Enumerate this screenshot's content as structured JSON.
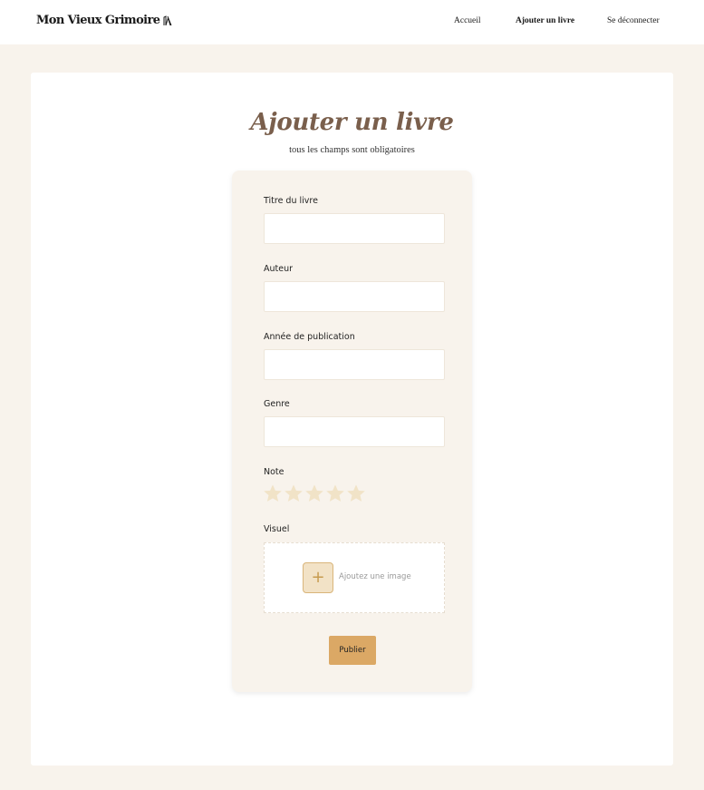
{
  "header": {
    "logo_text": "Mon Vieux Grimoire",
    "nav": {
      "home": "Accueil",
      "add_book": "Ajouter un livre",
      "logout": "Se déconnecter"
    }
  },
  "page": {
    "title": "Ajouter un livre",
    "subtitle": "tous les champs sont obligatoires"
  },
  "form": {
    "fields": {
      "title_label": "Titre du livre",
      "title_value": "",
      "author_label": "Auteur",
      "author_value": "",
      "year_label": "Année de publication",
      "year_value": "",
      "genre_label": "Genre",
      "genre_value": ""
    },
    "rating": {
      "label": "Note",
      "value": 0,
      "max": 5
    },
    "visual": {
      "label": "Visuel",
      "add_icon": "+",
      "add_text": "Ajoutez une image"
    },
    "submit_label": "Publier"
  },
  "colors": {
    "background": "#f8f3ec",
    "accent": "#dba865",
    "title": "#7a5f4c",
    "star_empty": "#f1e3c7"
  }
}
